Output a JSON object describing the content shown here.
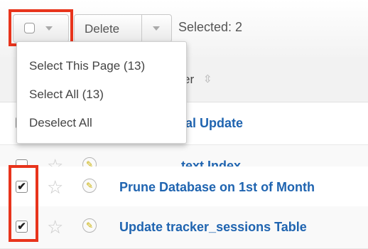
{
  "toolbar": {
    "delete_label": "Delete",
    "selected_text": "Selected: 2",
    "highlight_color": "#e8341c"
  },
  "header": {
    "name_suffix": "er",
    "sort_icon": "⇳"
  },
  "menu": {
    "items": [
      {
        "label": "Select This Page (13)"
      },
      {
        "label": "Select All (13)"
      },
      {
        "label": "Deselect All"
      }
    ]
  },
  "rows": [
    {
      "checked": false,
      "check_glyph": "",
      "name": "Prune Tracker Tables & Internal Update",
      "visible_name": "rnal Update"
    },
    {
      "checked": false,
      "check_glyph": "",
      "name": "Optimize Full-text Index",
      "visible_name": "text Index"
    },
    {
      "checked": true,
      "check_glyph": "✔",
      "name": "Prune Database on 1st of Month",
      "visible_name": "Prune Database on 1st of Month"
    },
    {
      "checked": true,
      "check_glyph": "✔",
      "name": "Update tracker_sessions Table",
      "visible_name": "Update tracker_sessions Table"
    }
  ],
  "icons": {
    "star": "☆",
    "edit": "✎"
  }
}
